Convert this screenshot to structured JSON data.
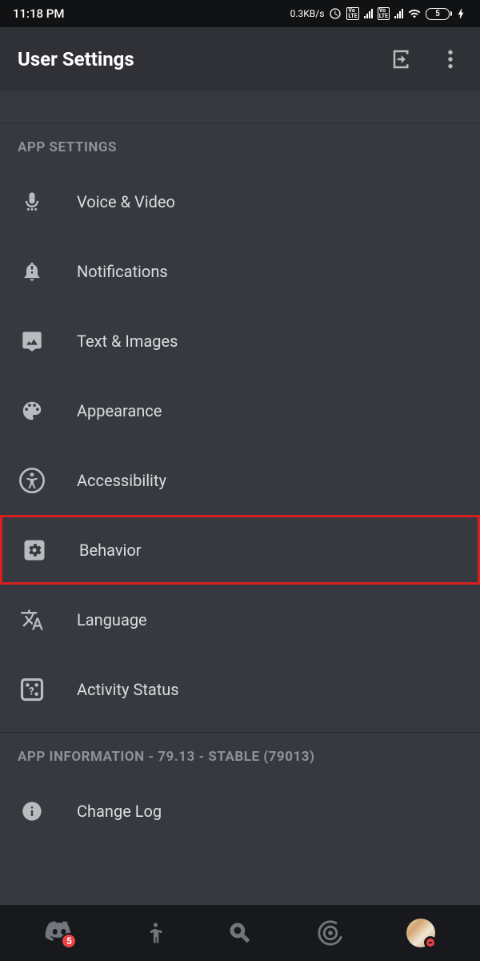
{
  "status_bar": {
    "time": "11:18 PM",
    "data_rate": "0.3KB/s",
    "battery_level": "5"
  },
  "header": {
    "title": "User Settings"
  },
  "sections": {
    "app_settings": {
      "title": "APP SETTINGS",
      "items": [
        {
          "label": "Voice & Video",
          "icon": "microphone-icon",
          "highlighted": false
        },
        {
          "label": "Notifications",
          "icon": "bell-icon",
          "highlighted": false
        },
        {
          "label": "Text & Images",
          "icon": "image-icon",
          "highlighted": false
        },
        {
          "label": "Appearance",
          "icon": "palette-icon",
          "highlighted": false
        },
        {
          "label": "Accessibility",
          "icon": "accessibility-icon",
          "highlighted": false
        },
        {
          "label": "Behavior",
          "icon": "gear-box-icon",
          "highlighted": true
        },
        {
          "label": "Language",
          "icon": "language-icon",
          "highlighted": false
        },
        {
          "label": "Activity Status",
          "icon": "dice-icon",
          "highlighted": false
        }
      ]
    },
    "app_information": {
      "title": "APP INFORMATION - 79.13 - STABLE (79013)",
      "items": [
        {
          "label": "Change Log",
          "icon": "info-icon",
          "highlighted": false
        }
      ]
    }
  },
  "bottom_nav": {
    "badge_count": "5"
  }
}
